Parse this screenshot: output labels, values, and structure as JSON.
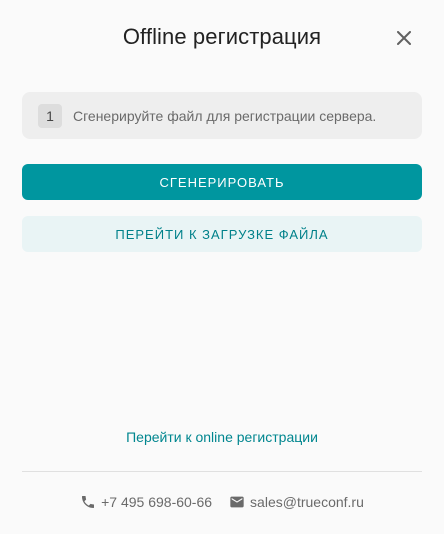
{
  "dialog": {
    "title": "Offline регистрация",
    "close_icon": "close-icon"
  },
  "step": {
    "number": "1",
    "text": "Сгенерируйте файл для регистрации сервера."
  },
  "buttons": {
    "generate_label": "СГЕНЕРИРОВАТЬ",
    "upload_label": "ПЕРЕЙТИ К ЗАГРУЗКЕ ФАЙЛА"
  },
  "online_link": "Перейти к online регистрации",
  "footer": {
    "phone": "+7 495 698-60-66",
    "phone_icon": "phone-icon",
    "email": "sales@trueconf.ru",
    "email_icon": "email-icon"
  },
  "colors": {
    "accent": "#00969f",
    "accent_light": "#e9f4f5",
    "link": "#00868f"
  }
}
